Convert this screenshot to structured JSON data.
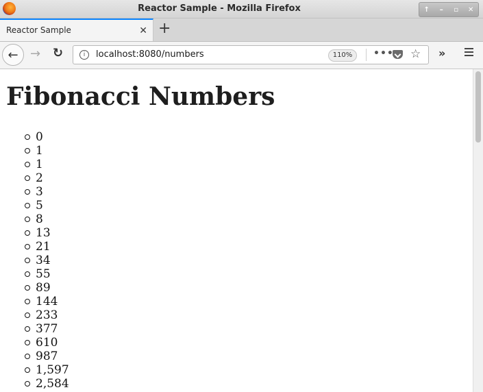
{
  "window": {
    "title": "Reactor Sample - Mozilla Firefox",
    "controls": [
      "↑",
      "–",
      "▫",
      "✕"
    ]
  },
  "tabs": [
    {
      "label": "Reactor Sample",
      "close": "✕"
    }
  ],
  "new_tab": "+",
  "nav": {
    "back": "←",
    "forward": "→",
    "reload": "↻",
    "info": "i",
    "url": "localhost:8080/numbers",
    "zoom": "110%",
    "more": "•••",
    "star": "☆",
    "overflow": "»"
  },
  "page": {
    "title": "Fibonacci Numbers",
    "numbers": [
      "0",
      "1",
      "1",
      "2",
      "3",
      "5",
      "8",
      "13",
      "21",
      "34",
      "55",
      "89",
      "144",
      "233",
      "377",
      "610",
      "987",
      "1,597",
      "2,584"
    ]
  },
  "colors": {
    "tab_accent": "#0a84ff",
    "chrome_bg": "#f4f4f4",
    "titlebar_bg": "#d4d4d4"
  }
}
